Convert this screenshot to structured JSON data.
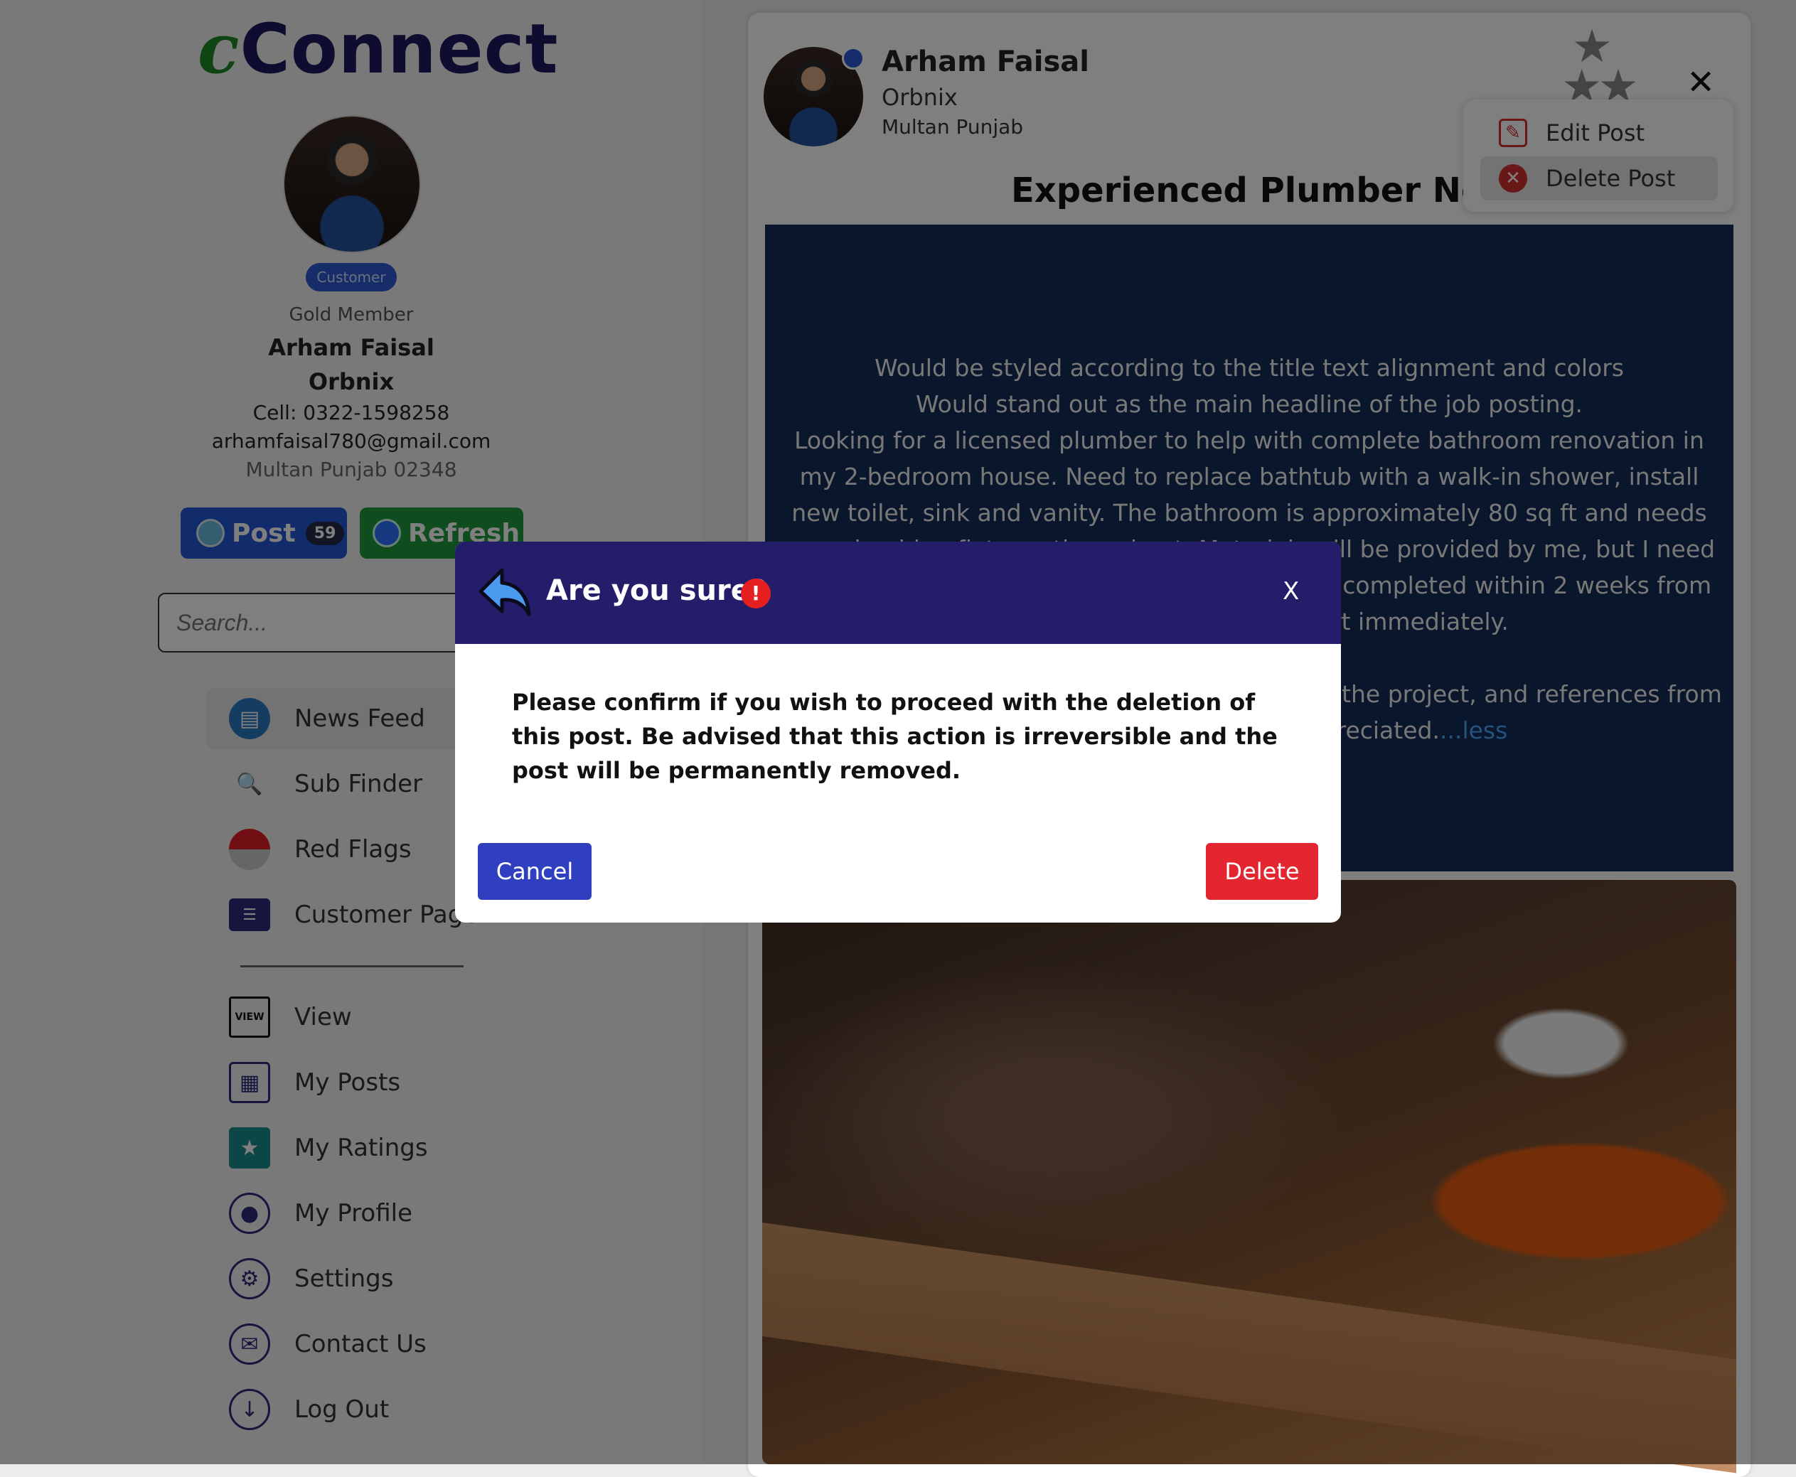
{
  "brand": {
    "prefix": "c",
    "name": "Connect"
  },
  "profile": {
    "role_badge": "Customer",
    "membership": "Gold Member",
    "name": "Arham Faisal",
    "company": "Orbnix",
    "cell": "Cell: 0322-1598258",
    "email": "arhamfaisal780@gmail.com",
    "location": "Multan Punjab 02348"
  },
  "actions": {
    "post_label": "Post",
    "post_count": "59",
    "refresh_label": "Refresh"
  },
  "search": {
    "placeholder": "Search..."
  },
  "nav": {
    "news_feed": "News Feed",
    "sub_finder": "Sub Finder",
    "red_flags": "Red Flags",
    "customer_page": "Customer Page",
    "view": "View",
    "my_posts": "My Posts",
    "my_ratings": "My Ratings",
    "my_profile": "My Profile",
    "settings": "Settings",
    "contact_us": "Contact Us",
    "log_out": "Log Out"
  },
  "post": {
    "author": "Arham Faisal",
    "company": "Orbnix",
    "location": "Multan Punjab",
    "title": "Experienced Plumber Needed",
    "body_line1": "Would be styled according to the title text alignment and colors",
    "body_line2": "Would stand out as the main headline of the job posting.",
    "body_line3": "Looking for a licensed plumber to help with complete bathroom renovation in my 2-bedroom house. Need to replace bathtub with a walk-in shower, install new toilet, sink and vanity. The bathroom is approximately 80 sq ft and needs new plumbing fixtures throughout. Materials will be provided by me, but I need professional installation. The work needs to be completed within 2 weeks from start date. Work needs to start immediately.",
    "body_line4": "Please provide an estimate of time to complete the project, and references from similar projects would be appreciated.",
    "less_link": "...less"
  },
  "post_menu": {
    "edit": "Edit Post",
    "delete": "Delete Post"
  },
  "modal": {
    "title": "Are you sure?",
    "close": "X",
    "message": "Please confirm if you wish to proceed with the deletion of this post. Be advised that this action is irreversible and the post will be permanently removed.",
    "cancel": "Cancel",
    "delete": "Delete"
  },
  "colors": {
    "brand_navy": "#231d6a",
    "brand_green": "#1d8a24",
    "danger": "#e3262f",
    "primary": "#2f3fbf"
  }
}
